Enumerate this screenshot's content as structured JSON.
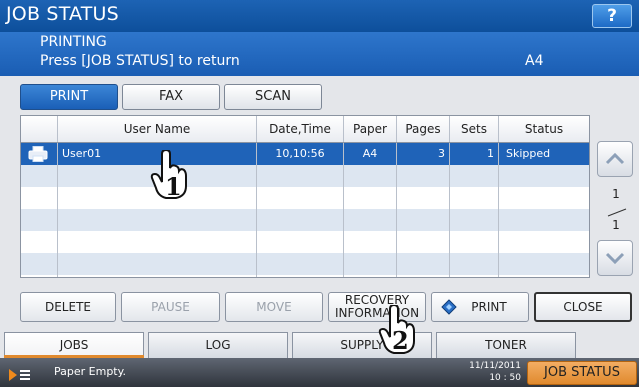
{
  "header": {
    "title": "JOB STATUS",
    "help_label": "?"
  },
  "status": {
    "line1": "PRINTING",
    "line2": "Press [JOB STATUS] to return",
    "paper": "A4"
  },
  "type_tabs": [
    {
      "label": "PRINT",
      "selected": true
    },
    {
      "label": "FAX",
      "selected": false
    },
    {
      "label": "SCAN",
      "selected": false
    }
  ],
  "table": {
    "columns": [
      "User Name",
      "Date,Time",
      "Paper",
      "Pages",
      "Sets",
      "Status"
    ],
    "rows": [
      {
        "user": "User01",
        "datetime": "10,10:56",
        "paper": "A4",
        "pages": "3",
        "sets": "1",
        "status": "Skipped",
        "selected": true
      }
    ]
  },
  "pager": {
    "current": "1",
    "total": "1"
  },
  "actions": {
    "delete": "DELETE",
    "pause": "PAUSE",
    "move": "MOVE",
    "recovery_line1": "RECOVERY",
    "recovery_line2": "INFORMATION",
    "print": "PRINT",
    "close": "CLOSE"
  },
  "bottom_tabs": [
    {
      "label": "JOBS",
      "active": true
    },
    {
      "label": "LOG",
      "active": false
    },
    {
      "label": "SUPPLY",
      "active": false
    },
    {
      "label": "TONER",
      "active": false
    }
  ],
  "bottombar": {
    "message": "Paper Empty.",
    "date": "11/11/2011",
    "time": "10 : 50",
    "job_status_label": "JOB STATUS"
  },
  "annotations": {
    "callout1": "1",
    "callout2": "2"
  },
  "colors": {
    "title_bg": "#0d4f9b",
    "selected_row": "#1f63b8",
    "accent_orange": "#e08a2e"
  }
}
